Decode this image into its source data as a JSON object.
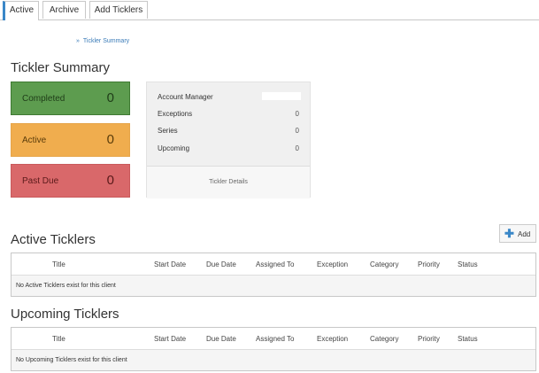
{
  "tabs": [
    "Active",
    "Archive",
    "Add Ticklers"
  ],
  "breadcrumb": {
    "separator": "»",
    "item": "Tickler Summary"
  },
  "summary": {
    "title": "Tickler Summary",
    "tiles": [
      {
        "label": "Completed",
        "count": "0",
        "color": "#5d9c4f"
      },
      {
        "label": "Active",
        "count": "0",
        "color": "#f0ad4e"
      },
      {
        "label": "Past Due",
        "count": "0",
        "color": "#d9686a"
      }
    ],
    "details": {
      "rows": [
        {
          "label": "Account Manager",
          "value": ""
        },
        {
          "label": "Exceptions",
          "value": "0"
        },
        {
          "label": "Series",
          "value": "0"
        },
        {
          "label": "Upcoming",
          "value": "0"
        }
      ],
      "footer": "Tickler Details"
    }
  },
  "active_ticklers": {
    "title": "Active Ticklers",
    "add_label": "Add",
    "columns": [
      "Title",
      "Start Date",
      "Due Date",
      "Assigned To",
      "Exception",
      "Category",
      "Priority",
      "Status"
    ],
    "empty_message": "No Active Ticklers exist for this client"
  },
  "upcoming_ticklers": {
    "title": "Upcoming Ticklers",
    "columns": [
      "Title",
      "Start Date",
      "Due Date",
      "Assigned To",
      "Exception",
      "Category",
      "Priority",
      "Status"
    ],
    "empty_message": "No Upcoming Ticklers exist for this client"
  },
  "colors": {
    "accent": "#3a87c8",
    "link": "#3a7bb8"
  }
}
